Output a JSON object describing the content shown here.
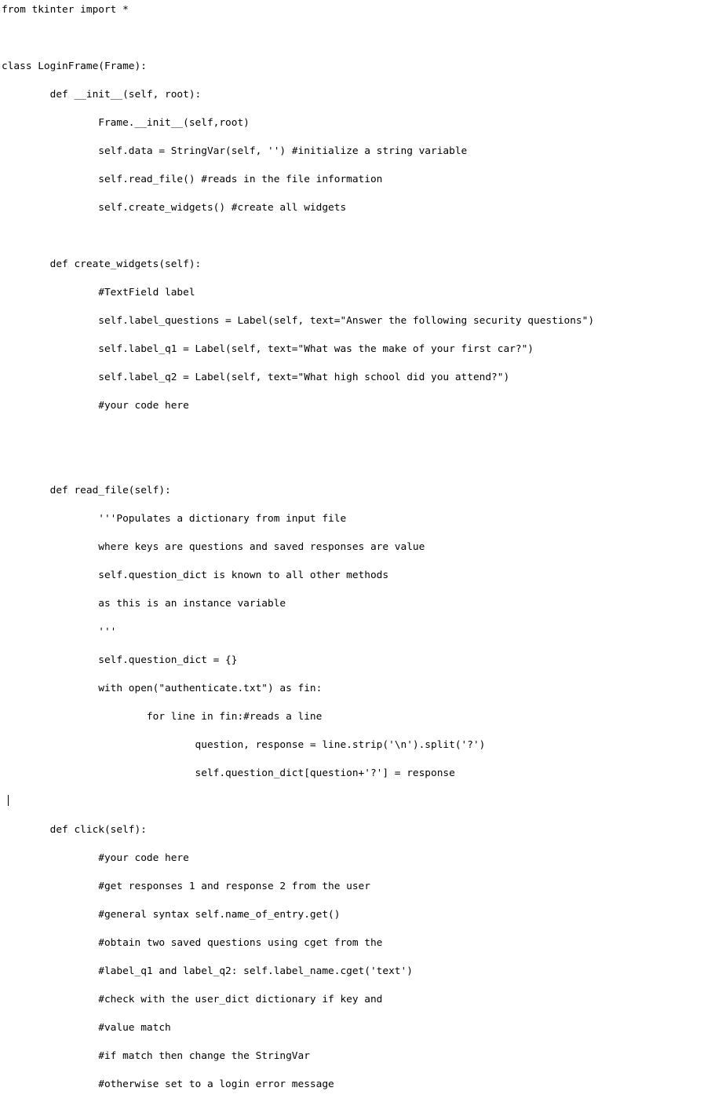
{
  "editor": {
    "language": "python",
    "background_color": "#ffffff",
    "text_color": "#000000",
    "caret_color": "#000000",
    "caret_line_index": 28,
    "font_size_px": 12.8,
    "line_height_px": 18,
    "indent_unit": "8 spaces",
    "lines": [
      "from tkinter import *",
      "",
      "class LoginFrame(Frame):",
      "        def __init__(self, root):",
      "                Frame.__init__(self,root)",
      "                self.data = StringVar(self, '') #initialize a string variable",
      "                self.read_file() #reads in the file information",
      "                self.create_widgets() #create all widgets",
      "",
      "        def create_widgets(self):",
      "                #TextField label",
      "                self.label_questions = Label(self, text=\"Answer the following security questions\")",
      "                self.label_q1 = Label(self, text=\"What was the make of your first car?\")",
      "                self.label_q2 = Label(self, text=\"What high school did you attend?\")",
      "                #your code here",
      "",
      "",
      "        def read_file(self):",
      "                '''Populates a dictionary from input file",
      "                where keys are questions and saved responses are value",
      "                self.question_dict is known to all other methods",
      "                as this is an instance variable",
      "                '''",
      "                self.question_dict = {}",
      "                with open(\"authenticate.txt\") as fin:",
      "                        for line in fin:#reads a line",
      "                                question, response = line.strip('\\n').split('?')",
      "                                self.question_dict[question+'?'] = response",
      "",
      "        def click(self):",
      "                #your code here",
      "                #get responses 1 and response 2 from the user",
      "                #general syntax self.name_of_entry.get()",
      "                #obtain two saved questions using cget from the",
      "                #label_q1 and label_q2: self.label_name.cget('text')",
      "                #check with the user_dict dictionary if key and",
      "                #value match",
      "                #if match then change the StringVar",
      "                #otherwise set to a login error message"
    ]
  }
}
